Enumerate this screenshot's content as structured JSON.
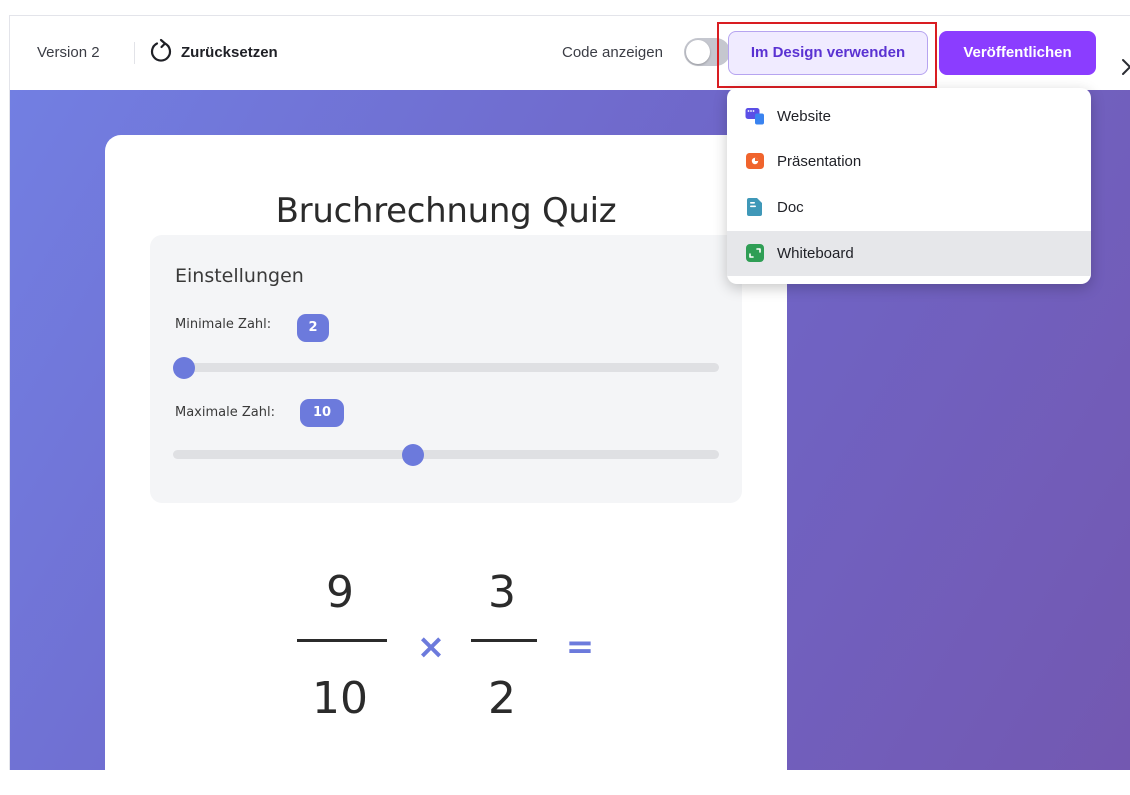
{
  "toolbar": {
    "version_label": "Version 2",
    "reset_label": "Zurücksetzen",
    "code_toggle_label": "Code anzeigen",
    "code_toggle_on": false,
    "use_in_design_label": "Im Design verwenden",
    "publish_label": "Veröffentlichen"
  },
  "dropdown": {
    "items": [
      {
        "label": "Website",
        "icon": "website-icon"
      },
      {
        "label": "Präsentation",
        "icon": "presentation-icon"
      },
      {
        "label": "Doc",
        "icon": "doc-icon"
      },
      {
        "label": "Whiteboard",
        "icon": "whiteboard-icon"
      }
    ],
    "hovered_item": "Whiteboard"
  },
  "quiz": {
    "title": "Bruchrechnung Quiz",
    "settings": {
      "title": "Einstellungen",
      "min_label": "Minimale Zahl:",
      "min_value": "2",
      "min_slider_fraction": 0.02,
      "max_label": "Maximale Zahl:",
      "max_value": "10",
      "max_slider_fraction": 0.44
    },
    "fraction1": {
      "numerator": "9",
      "denominator": "10"
    },
    "operator": "×",
    "fraction2": {
      "numerator": "3",
      "denominator": "2"
    },
    "equals": "="
  },
  "colors": {
    "accent": "#6c7adc",
    "publish": "#8b3dff",
    "highlight_box": "#d91d22",
    "use_button_text": "#5a32d2"
  }
}
